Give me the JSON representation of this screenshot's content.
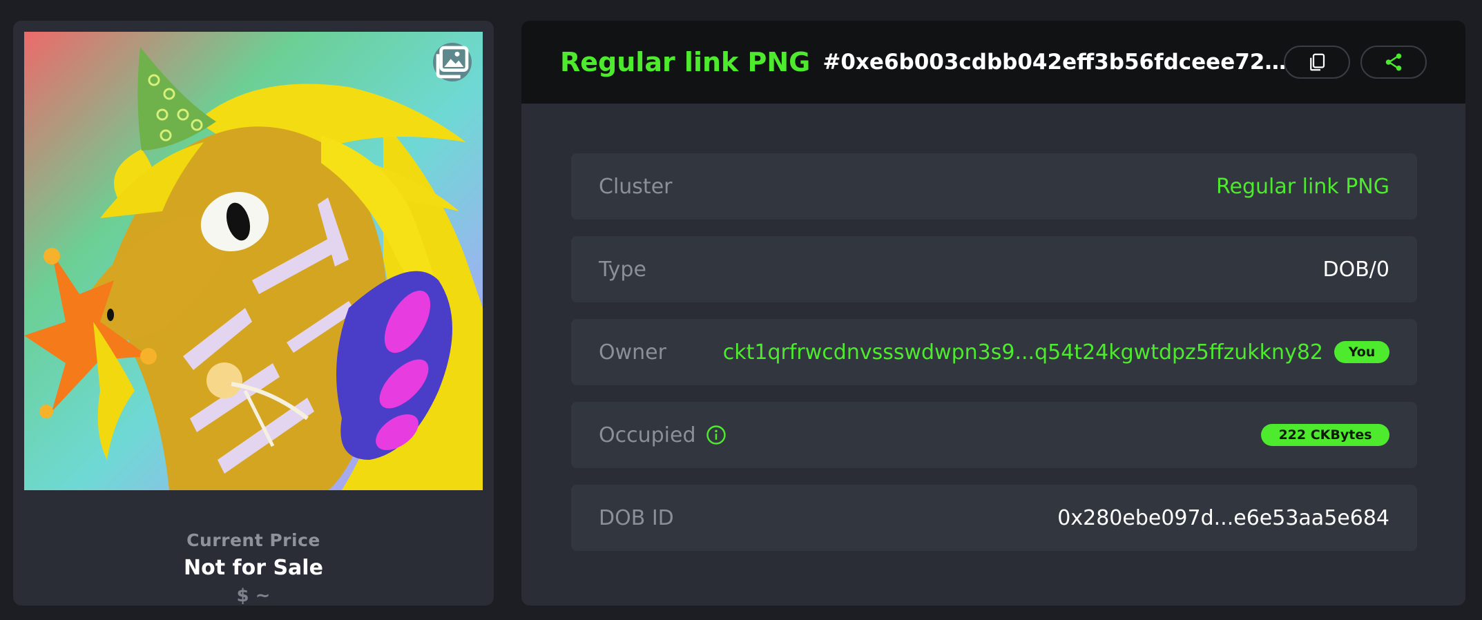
{
  "nft": {
    "image_alt": "Unicorn artwork",
    "price_label": "Current Price",
    "price_value": "Not for Sale",
    "price_usd": "$ ~"
  },
  "header": {
    "title": "Regular link PNG",
    "token_id": "#0xe6b003cdbb042eff3b56fdceee725b42...",
    "copy_icon": "copy-icon",
    "share_icon": "share-icon"
  },
  "details": {
    "cluster": {
      "label": "Cluster",
      "value": "Regular link PNG"
    },
    "type": {
      "label": "Type",
      "value": "DOB/0"
    },
    "owner": {
      "label": "Owner",
      "value": "ckt1qrfrwcdnvssswdwpn3s9...q54t24kgwtdpz5ffzukkny82",
      "badge": "You"
    },
    "occupied": {
      "label": "Occupied",
      "value": "222 CKBytes"
    },
    "dob_id": {
      "label": "DOB ID",
      "value": "0x280ebe097d...e6e53aa5e684"
    }
  },
  "colors": {
    "accent": "#4eea2e",
    "background": "#1c1e23",
    "panel": "#2a2d36",
    "row": "#32363f"
  }
}
